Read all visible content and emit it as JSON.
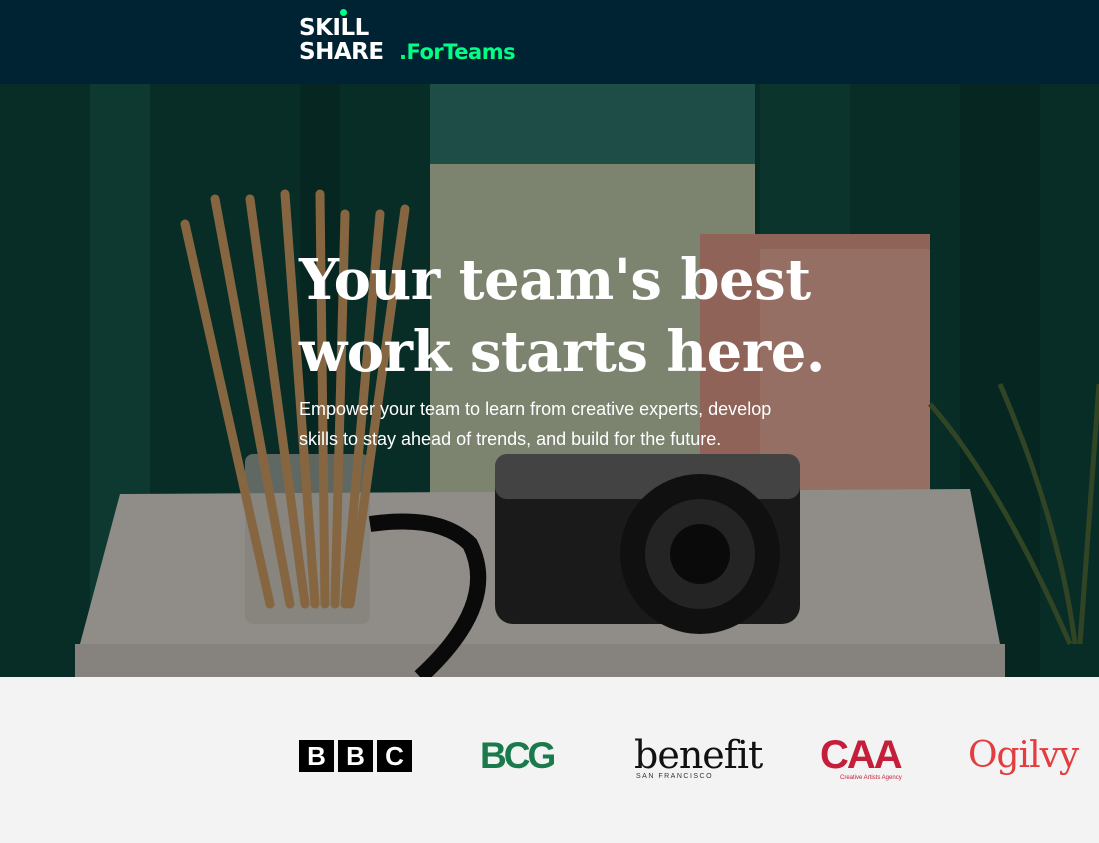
{
  "header": {
    "logo_line1": "SKILL",
    "logo_line2": "SHARE",
    "logo_suffix": ".ForTeams",
    "bg_color": "#002333",
    "accent_color": "#00ff84"
  },
  "hero": {
    "title_line1": "Your team's best",
    "title_line2": "work starts here.",
    "subtitle_line1": "Empower your team to learn from creative experts, develop",
    "subtitle_line2": "skills to stay ahead of trends, and build for the future."
  },
  "logos": {
    "bbc_letters": [
      "B",
      "B",
      "C"
    ],
    "bcg": "BCG",
    "benefit": "benefit",
    "benefit_sub": "SAN FRANCISCO",
    "caa": "CAA",
    "caa_sub": "Creative Artists Agency",
    "ogilvy": "Ogilvy"
  }
}
